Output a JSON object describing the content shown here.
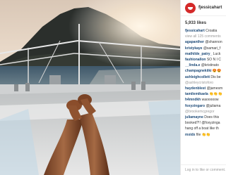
{
  "header": {
    "username": "fjessicahart"
  },
  "likes": "5,933 likes",
  "comments": [
    {
      "user": "fjessicahart",
      "text": " Croatia"
    },
    {
      "user": "",
      "text": "view all 125 comments",
      "muted": true
    },
    {
      "user": "agapanther",
      "text": " @shannon"
    },
    {
      "user": "kristykaye",
      "text": " @samari_f"
    },
    {
      "user": "mathilde_patry_",
      "text": " Luck"
    },
    {
      "user": "fashionallon",
      "text": " SO N I C"
    },
    {
      "user": "__linda.e",
      "text": " @kristinato"
    },
    {
      "user": "champagnekiiki",
      "text": " 😍😍"
    },
    {
      "user": "ashleighcollett",
      "text": " Dis be"
    },
    {
      "user": "",
      "text": "@ashleycristoforo",
      "muted": true
    },
    {
      "user": "haydenblest",
      "text": " @jamesm"
    },
    {
      "user": "tamilemikaela",
      "text": " 👏👏👏"
    },
    {
      "user": "h4mndkh",
      "text": " waooooow"
    },
    {
      "user": "foxyzingaro",
      "text": " @juliama"
    },
    {
      "user": "",
      "text": "@brookemcgregor",
      "muted": true
    },
    {
      "user": "juliamayne",
      "text": " Does this"
    },
    {
      "user": "",
      "text": "booked?!! @foxyzinga",
      "muted": false
    },
    {
      "user": "",
      "text": "hang off a boat like th",
      "muted": false
    },
    {
      "user": "mxidx",
      "text": " file 👏👏"
    }
  ],
  "footer": {
    "login_prompt": "Log in to like or comment."
  },
  "colors": {
    "avatar": "#d42a2a",
    "username_link": "#1d4a77"
  }
}
